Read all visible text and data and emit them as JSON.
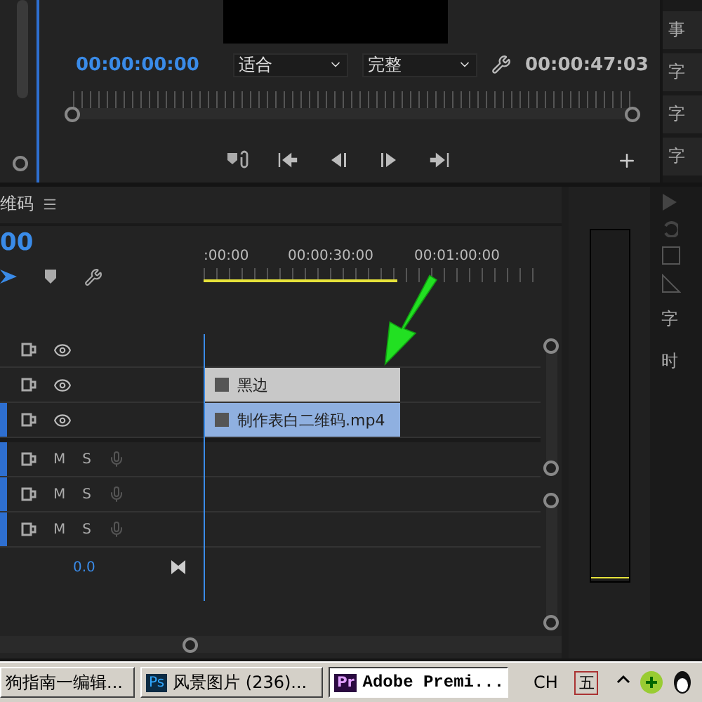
{
  "program_monitor": {
    "timecode": "00:00:00:00",
    "zoom_select": "适合",
    "quality_select": "完整",
    "duration": "00:00:47:03"
  },
  "right_panel_tabs": [
    "事",
    "字",
    "字",
    "字"
  ],
  "timeline": {
    "title": "维码",
    "timecode": "00",
    "ruler_labels": [
      ":00:00",
      "00:00:30:00",
      "00:01:00:00"
    ],
    "video_tracks": [
      {
        "targeted": false
      },
      {
        "targeted": false,
        "clip": {
          "name": "黑边",
          "kind": "graphic"
        }
      },
      {
        "targeted": true,
        "clip": {
          "name": "制作表白二维码.mp4",
          "kind": "video"
        }
      }
    ],
    "audio_tracks": [
      {
        "targeted": true,
        "mute": "M",
        "solo": "S"
      },
      {
        "targeted": true,
        "mute": "M",
        "solo": "S"
      },
      {
        "targeted": true,
        "mute": "M",
        "solo": "S"
      }
    ],
    "master_level": "0.0"
  },
  "tools_panel_labels": [
    "字",
    "时"
  ],
  "taskbar": {
    "items": [
      {
        "label": "狗指南一编辑...",
        "selected": false
      },
      {
        "badge": "Ps",
        "label": "风景图片 (236)...",
        "selected": false
      },
      {
        "badge": "Pr",
        "label": "Adobe Premi...",
        "selected": true
      }
    ],
    "language": "CH",
    "ime": "五"
  }
}
